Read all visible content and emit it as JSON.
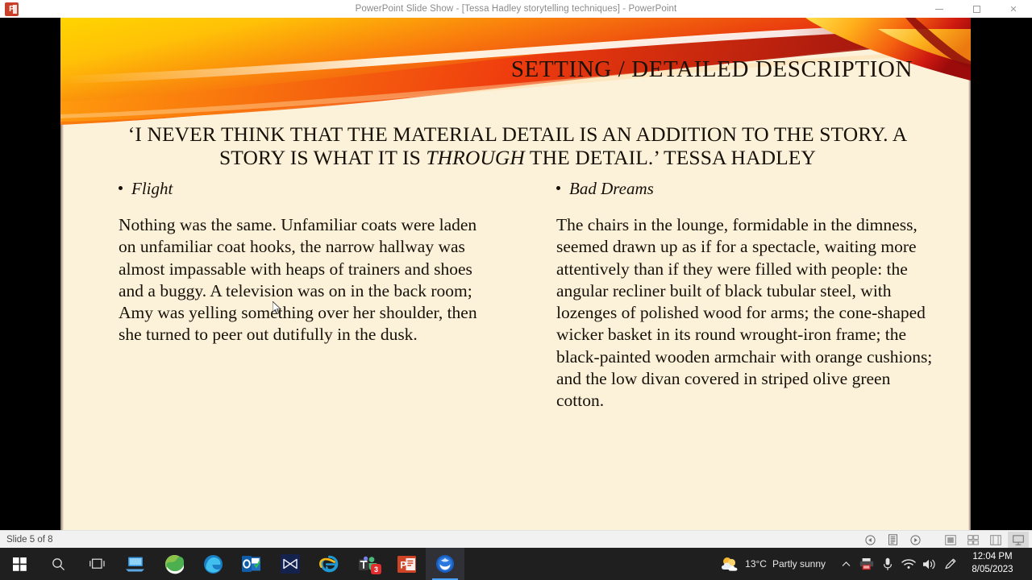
{
  "window": {
    "title": "PowerPoint Slide Show  -  [Tessa Hadley storytelling techniques]  -  PowerPoint",
    "app_icon": "powerpoint-icon",
    "controls": {
      "minimize": "minimize-icon",
      "maximize": "maximize-icon",
      "close": "✕"
    }
  },
  "slide": {
    "background_color": "#fcf2da",
    "banner_colors": {
      "yellow": "#ffd11a",
      "orange": "#f47a10",
      "red": "#d81414",
      "dark_red": "#8c0d0d",
      "highlight": "#fff6e4"
    },
    "title": "SETTING / DETAILED DESCRIPTION",
    "quote": {
      "line1_pre": "‘I NEVER THINK THAT THE MATERIAL DETAIL IS AN ADDITION TO THE",
      "line2_pre": "STORY. A STORY IS WHAT IT IS ",
      "line2_italic": "THROUGH",
      "line2_post": " THE DETAIL.’ TESSA HADLEY"
    },
    "columns": [
      {
        "heading": "Flight",
        "body": "Nothing was the same. Unfamiliar coats were laden on unfamiliar coat hooks, the narrow hallway was almost impassable with heaps of trainers and shoes and a buggy. A television was on in the back room; Amy was yelling something over her shoulder, then she turned to peer out dutifully in the dusk."
      },
      {
        "heading": "Bad Dreams",
        "body": "The chairs in the lounge, formidable in the dimness, seemed drawn up as if  for a spectacle, waiting more attentively than if  they were filled with people: the angular recliner built of black tubular steel, with lozenges of  polished wood for arms; the cone-shaped wicker basket in its round wrought-iron frame; the black-painted wooden armchair with orange cushions; and the low divan covered in striped olive green cotton."
      }
    ]
  },
  "statusbar": {
    "slide_indicator": "Slide 5 of 8",
    "buttons": [
      {
        "name": "previous-slide-button",
        "glyph": "◀"
      },
      {
        "name": "notes-button",
        "glyph": "☰"
      },
      {
        "name": "next-slide-button",
        "glyph": "▶"
      }
    ],
    "view_buttons": [
      {
        "name": "normal-view-button",
        "glyph": "▣",
        "selected": false
      },
      {
        "name": "slide-sorter-view-button",
        "glyph": "⊞",
        "selected": false
      },
      {
        "name": "reading-view-button",
        "glyph": "▥",
        "selected": false
      },
      {
        "name": "slide-show-view-button",
        "glyph": "⚇",
        "selected": true
      }
    ]
  },
  "taskbar": {
    "items": [
      {
        "name": "start-button",
        "icon": "windows-logo-icon",
        "color": "#ffffff"
      },
      {
        "name": "search-button",
        "icon": "search-icon",
        "color": "#d8d8d8"
      },
      {
        "name": "task-view-button",
        "icon": "task-view-icon",
        "color": "#d8d8d8"
      },
      {
        "name": "remote-desktop-button",
        "icon": "remote-desktop-icon",
        "color": "#3fa9f5"
      },
      {
        "name": "app-green-globe-button",
        "icon": "green-globe-icon",
        "color": "#5cb85c"
      },
      {
        "name": "edge-button",
        "icon": "edge-icon",
        "color": "#1a9ae0"
      },
      {
        "name": "outlook-button",
        "icon": "outlook-icon",
        "color": "#0f6cbd"
      },
      {
        "name": "mail-button",
        "icon": "mail-bowtie-icon",
        "color": "#13224a"
      },
      {
        "name": "internet-explorer-button",
        "icon": "internet-explorer-icon",
        "color": "#3ba7e0"
      },
      {
        "name": "teams-button",
        "icon": "teams-icon",
        "color": "#5b5fc7",
        "badge": "3"
      },
      {
        "name": "powerpoint-button",
        "icon": "powerpoint-icon",
        "color": "#d04423"
      },
      {
        "name": "active-app-button",
        "icon": "blue-shield-icon",
        "color": "#1f6fd0",
        "active": true
      }
    ],
    "weather": {
      "icon": "partly-sunny-icon",
      "temperature": "13°C",
      "condition": "Partly sunny"
    },
    "tray_icons": [
      {
        "name": "show-hidden-icons-button",
        "glyph": "∧"
      },
      {
        "name": "printer-icon",
        "glyph": "⎙"
      },
      {
        "name": "microphone-icon",
        "glyph": "Ἲ4"
      },
      {
        "name": "wifi-icon",
        "glyph": "◠"
      },
      {
        "name": "volume-icon",
        "glyph": "ὐA"
      },
      {
        "name": "pen-icon",
        "glyph": "✎"
      }
    ],
    "clock": {
      "time": "12:04 PM",
      "date": "8/05/2023"
    }
  }
}
